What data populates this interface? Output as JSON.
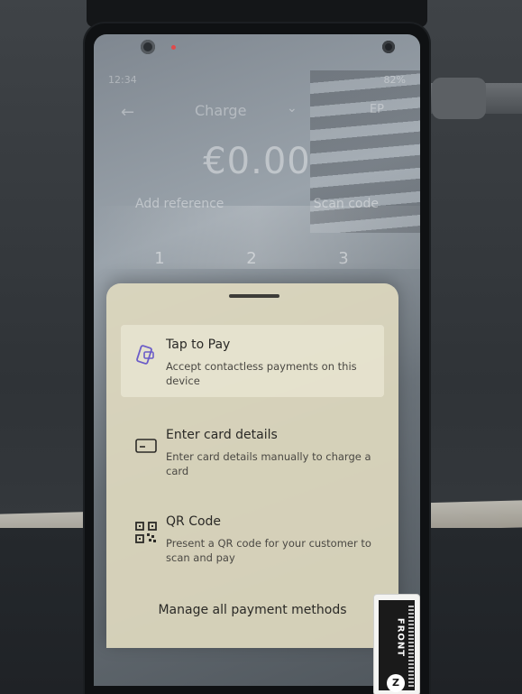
{
  "status_bar": {
    "left": "12:34",
    "right": "82%"
  },
  "charge_header": {
    "back_icon": "back-arrow-icon",
    "title": "Charge",
    "chevron_icon": "chevron-down-icon",
    "badge": "EP"
  },
  "amount": "€0.00",
  "reference": {
    "add_reference": "Add reference",
    "scan_code": "Scan code"
  },
  "keypad": [
    "1",
    "2",
    "3"
  ],
  "payment_sheet": {
    "options": [
      {
        "icon": "tap-to-pay-icon",
        "title": "Tap to Pay",
        "description": "Accept contactless payments on this device"
      },
      {
        "icon": "card-icon",
        "title": "Enter card details",
        "description": "Enter card details manually to charge a card"
      },
      {
        "icon": "qr-code-icon",
        "title": "QR Code",
        "description": "Present a QR code for your customer to scan and pay"
      }
    ],
    "manage_label": "Manage all payment methods"
  },
  "sticker": {
    "label": "FRONT",
    "logo": "Z"
  },
  "colors": {
    "sheet_background": "#ded8be",
    "sheet_text": "#2c2b28",
    "accent_icon": "#6b5cc8"
  }
}
